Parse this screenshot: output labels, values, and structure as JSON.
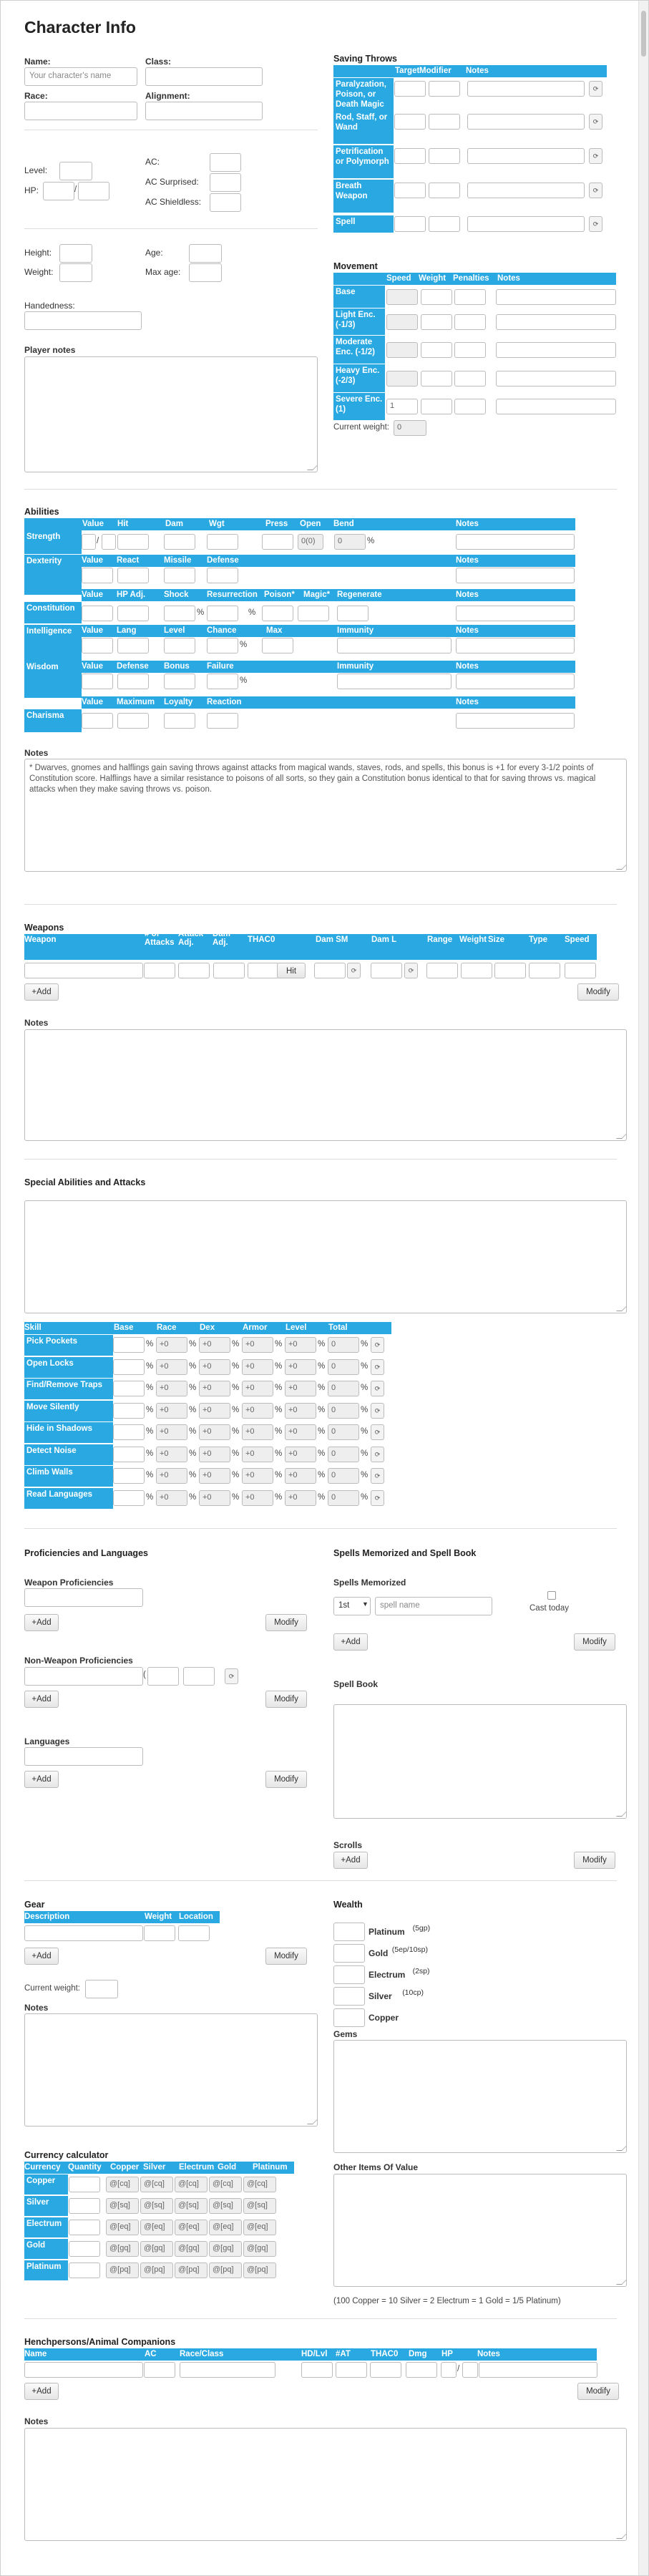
{
  "title": "Character Info",
  "basic": {
    "name_label": "Name:",
    "name_placeholder": "Your character's name",
    "class_label": "Class:",
    "race_label": "Race:",
    "alignment_label": "Alignment:",
    "level_label": "Level:",
    "hp_label": "HP:",
    "hp_sep": "/",
    "ac_label": "AC:",
    "ac_surprised_label": "AC Surprised:",
    "ac_shieldless_label": "AC Shieldless:",
    "height_label": "Height:",
    "weight_label": "Weight:",
    "age_label": "Age:",
    "max_age_label": "Max age:",
    "handedness_label": "Handedness:",
    "player_notes_label": "Player notes"
  },
  "saving_throws": {
    "title": "Saving Throws",
    "headers": [
      "Target",
      "Modifier",
      "Notes"
    ],
    "rows": [
      "Paralyzation, Poison, or Death Magic",
      "Rod, Staff, or Wand",
      "Petrification or Polymorph",
      "Breath Weapon",
      "Spell"
    ]
  },
  "movement": {
    "title": "Movement",
    "headers": [
      "Speed",
      "Weight",
      "Penalties",
      "Notes"
    ],
    "rows": [
      "Base",
      "Light Enc. (-1/3)",
      "Moderate Enc. (-1/2)",
      "Heavy Enc. (-2/3)",
      "Severe Enc. (1)"
    ],
    "severe_speed": "1",
    "current_weight_label": "Current weight:",
    "current_weight": "0"
  },
  "abilities": {
    "title": "Abilities",
    "str_headers": [
      "Value",
      "Hit",
      "Dam",
      "Wgt",
      "Press",
      "Open",
      "Bend",
      "Notes"
    ],
    "str_label": "Strength",
    "str_value_sep": "/",
    "str_open": "0(0)",
    "str_bend": "0",
    "pct": "%",
    "dex_headers": [
      "Value",
      "React",
      "Missile",
      "Defense",
      "Notes"
    ],
    "dex_label": "Dexterity",
    "con_headers": [
      "Value",
      "HP Adj.",
      "Shock",
      "Resurrection",
      "Poison*",
      "Magic*",
      "Regenerate",
      "Notes"
    ],
    "con_label": "Constitution",
    "int_headers": [
      "Value",
      "Lang",
      "Level",
      "Chance",
      "Max",
      "Immunity",
      "Notes"
    ],
    "int_label": "Intelligence",
    "wis_headers": [
      "Value",
      "Defense",
      "Bonus",
      "Failure",
      "Immunity",
      "Notes"
    ],
    "wis_label": "Wisdom",
    "cha_headers": [
      "Value",
      "Maximum",
      "Loyalty",
      "Reaction",
      "Notes"
    ],
    "cha_label": "Charisma",
    "notes_label": "Notes",
    "notes_text": "* Dwarves, gnomes and halflings gain saving throws against attacks from magical wands, staves, rods, and spells, this bonus is +1 for every 3-1/2 points of Constitution score. Halflings have a similar resistance to poisons of all sorts, so they gain a Constitution bonus identical to that for saving throws vs. magical attacks when they make saving throws vs. poison."
  },
  "weapons": {
    "title": "Weapons",
    "headers": [
      "Weapon",
      "# of Attacks",
      "Attack Adj.",
      "Dam Adj.",
      "THAC0",
      "Dam SM",
      "Dam L",
      "Range",
      "Weight",
      "Size",
      "Type",
      "Speed"
    ],
    "hit_label": "Hit",
    "add": "+Add",
    "modify": "Modify",
    "notes_label": "Notes"
  },
  "special": {
    "title": "Special Abilities and Attacks"
  },
  "skills": {
    "headers": [
      "Skill",
      "Base",
      "Race",
      "Dex",
      "Armor",
      "Level",
      "Total"
    ],
    "rows": [
      "Pick Pockets",
      "Open Locks",
      "Find/Remove Traps",
      "Move Silently",
      "Hide in Shadows",
      "Detect Noise",
      "Climb Walls",
      "Read Languages"
    ],
    "plus": "+0",
    "zero": "0",
    "pct": "%"
  },
  "proficiencies": {
    "title": "Proficiencies and Languages",
    "weapon_label": "Weapon Proficiencies",
    "nonweapon_label": "Non-Weapon Proficiencies",
    "languages_label": "Languages",
    "add": "+Add",
    "modify": "Modify"
  },
  "spells": {
    "title": "Spells Memorized and Spell Book",
    "memorized_label": "Spells Memorized",
    "level_option": "1st",
    "spell_placeholder": "spell name",
    "cast_today": "Cast today",
    "spellbook_label": "Spell Book",
    "scrolls_label": "Scrolls",
    "add": "+Add",
    "modify": "Modify"
  },
  "gear": {
    "title": "Gear",
    "headers": [
      "Description",
      "Weight",
      "Location"
    ],
    "add": "+Add",
    "modify": "Modify",
    "current_weight_label": "Current weight:",
    "notes_label": "Notes"
  },
  "wealth": {
    "title": "Wealth",
    "coins": [
      {
        "name": "Platinum",
        "note": "(5gp)"
      },
      {
        "name": "Gold",
        "note": "(5ep/10sp)"
      },
      {
        "name": "Electrum",
        "note": "(2sp)"
      },
      {
        "name": "Silver",
        "note": "(10cp)"
      },
      {
        "name": "Copper",
        "note": ""
      }
    ],
    "gems_label": "Gems",
    "other_label": "Other Items Of Value",
    "conversion": "(100 Copper = 10 Silver = 2 Electrum = 1 Gold = 1/5 Platinum)"
  },
  "currency": {
    "title": "Currency calculator",
    "headers": [
      "Currency",
      "Quantity",
      "Copper",
      "Silver",
      "Electrum",
      "Gold",
      "Platinum"
    ],
    "rows": [
      {
        "name": "Copper",
        "vals": [
          "@[cq]",
          "@[cq]",
          "@[cq]",
          "@[cq]",
          "@[cq]"
        ]
      },
      {
        "name": "Silver",
        "vals": [
          "@[sq]",
          "@[sq]",
          "@[sq]",
          "@[sq]",
          "@[sq]"
        ]
      },
      {
        "name": "Electrum",
        "vals": [
          "@[eq]",
          "@[eq]",
          "@[eq]",
          "@[eq]",
          "@[eq]"
        ]
      },
      {
        "name": "Gold",
        "vals": [
          "@[gq]",
          "@[gq]",
          "@[gq]",
          "@[gq]",
          "@[gq]"
        ]
      },
      {
        "name": "Platinum",
        "vals": [
          "@[pq]",
          "@[pq]",
          "@[pq]",
          "@[pq]",
          "@[pq]"
        ]
      }
    ]
  },
  "henchmen": {
    "title": "Henchpersons/Animal Companions",
    "headers": [
      "Name",
      "AC",
      "Race/Class",
      "HD/Lvl",
      "#AT",
      "THAC0",
      "Dmg",
      "HP",
      "Notes"
    ],
    "hp_sep": "/",
    "add": "+Add",
    "modify": "Modify",
    "notes_label": "Notes"
  }
}
